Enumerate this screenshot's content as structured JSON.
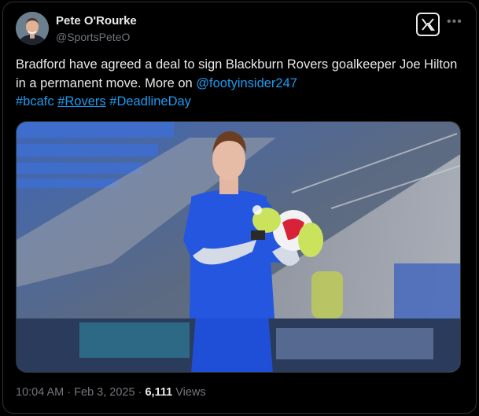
{
  "author": {
    "name": "Pete O'Rourke",
    "handle": "@SportsPeteO"
  },
  "icons": {
    "logo": "x-logo-icon",
    "more": "more-options-icon"
  },
  "post": {
    "text_part1": "Bradford have agreed a deal to sign Blackburn Rovers goalkeeper Joe Hilton in a permanent move. More on ",
    "mention": "@footyinsider247",
    "hashtag1": "#bcafc",
    "hashtag2": "#Rovers",
    "hashtag3": "#DeadlineDay"
  },
  "meta": {
    "time": "10:04 AM",
    "separator": "·",
    "date": "Feb 3, 2025",
    "separator2": "·",
    "views_count": "6,111",
    "views_label": "Views"
  },
  "colors": {
    "background": "#000000",
    "text": "#e7e9ea",
    "muted": "#71767b",
    "link": "#1d9bf0",
    "border": "#2f3336"
  }
}
